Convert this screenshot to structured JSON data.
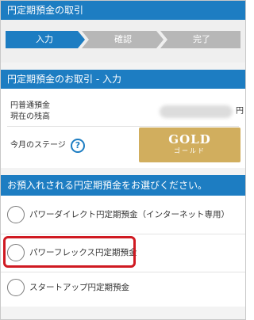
{
  "header": {
    "title": "円定期預金の取引"
  },
  "steps": [
    {
      "label": "入力",
      "state": "active"
    },
    {
      "label": "確認",
      "state": "inactive"
    },
    {
      "label": "完了",
      "state": "inactive"
    }
  ],
  "section_input": {
    "title": "円定期預金のお取引 - 入力"
  },
  "balance": {
    "label_line1": "円普通預金",
    "label_line2": "現在の残高",
    "unit": "円"
  },
  "stage": {
    "label": "今月のステージ",
    "help_symbol": "?",
    "badge_main": "GOLD",
    "badge_sub": "ゴールド"
  },
  "section_select": {
    "title": "お預入れされる円定期預金をお選びください。"
  },
  "options": [
    {
      "label": "パワーダイレクト円定期預金（インターネット専用）"
    },
    {
      "label": "パワーフレックス円定期預金"
    },
    {
      "label": "スタートアップ円定期預金"
    }
  ],
  "colors": {
    "header_blue": "#1d7dc2",
    "step_active": "#1d7dc2",
    "step_inactive": "#b7b7b7",
    "gold": "#d1ae5e",
    "highlight_red": "#d01a22"
  }
}
